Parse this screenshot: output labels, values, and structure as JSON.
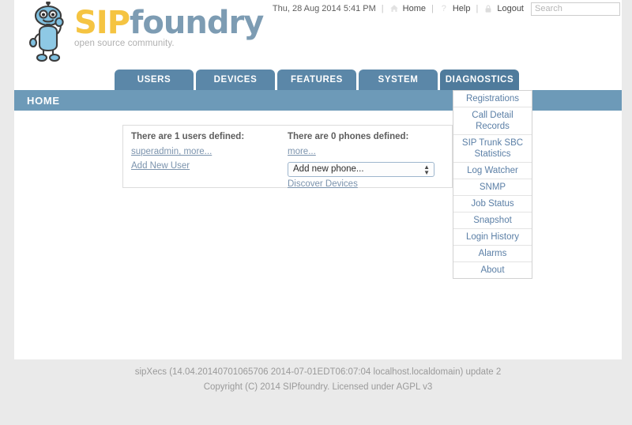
{
  "topbar": {
    "datetime": "Thu, 28 Aug 2014 5:41 PM",
    "separator": "|",
    "home_label": "Home",
    "home_icon": "house-icon",
    "help_label": "Help",
    "help_icon": "question-mark-icon",
    "logout_label": "Logout",
    "logout_icon": "padlock-icon",
    "search_placeholder": "Search",
    "search_value": ""
  },
  "logo": {
    "brand_sip": "SIP",
    "brand_foundry": "foundry",
    "tagline": "open source community.",
    "mascot": "robot-mascot-icon",
    "color_sip": "#f5c442",
    "color_foundry": "#7d9cb3"
  },
  "nav": {
    "tabs": [
      {
        "label": "USERS",
        "active": false
      },
      {
        "label": "DEVICES",
        "active": false
      },
      {
        "label": "FEATURES",
        "active": false
      },
      {
        "label": "SYSTEM",
        "active": false
      },
      {
        "label": "DIAGNOSTICS",
        "active": true
      }
    ],
    "tab_color": "#5b87a8",
    "tab_active_color": "#4f7b9c"
  },
  "dropdown": {
    "open_for": "DIAGNOSTICS",
    "items": [
      "Registrations",
      "Call Detail Records",
      "SIP Trunk SBC Statistics",
      "Log Watcher",
      "SNMP",
      "Job Status",
      "Snapshot",
      "Login History",
      "Alarms",
      "About"
    ]
  },
  "page": {
    "banner_title": "HOME",
    "banner_color": "#6d9ab8"
  },
  "main": {
    "users": {
      "title": "There are 1 users defined:",
      "list_link": "superadmin, more...",
      "add_link": "Add New User"
    },
    "phones": {
      "title": "There are 0 phones defined:",
      "more_link": "more...",
      "select_value": "Add new phone...",
      "select_options": [
        "Add new phone..."
      ],
      "discover_link": "Discover Devices"
    }
  },
  "footer": {
    "line1": "sipXecs (14.04.20140701065706 2014-07-01EDT06:07:04 localhost.localdomain) update 2",
    "line2": "Copyright (C) 2014 SIPfoundry. Licensed under AGPL v3"
  }
}
